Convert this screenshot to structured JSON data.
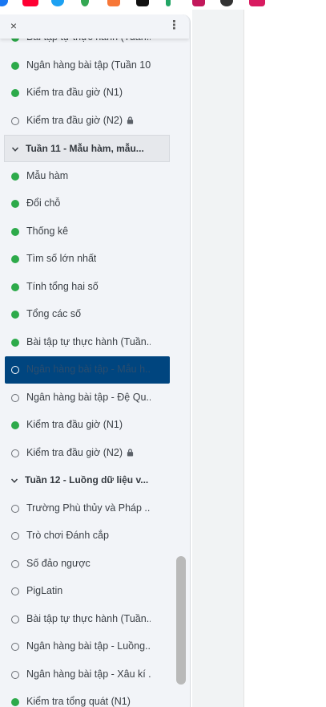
{
  "panel": {
    "close_icon": "×",
    "menu_icon": "⋮"
  },
  "items": [
    {
      "label": "Bài tập tự thực hành (Tuần...",
      "status": "done"
    },
    {
      "label": "Ngân hàng bài tập (Tuần 10)",
      "status": "done"
    },
    {
      "label": "Kiểm tra đầu giờ (N1)",
      "status": "done"
    },
    {
      "label": "Kiểm tra đầu giờ (N2)",
      "status": "todo",
      "locked": true
    },
    {
      "section": "Tuần 11 - Mẫu hàm, mẫu..."
    },
    {
      "label": "Mẫu hàm",
      "status": "done"
    },
    {
      "label": "Đổi chỗ",
      "status": "done"
    },
    {
      "label": "Thống kê",
      "status": "done"
    },
    {
      "label": "Tìm số lớn nhất",
      "status": "done"
    },
    {
      "label": "Tính tổng hai số",
      "status": "done"
    },
    {
      "label": "Tổng các số",
      "status": "done"
    },
    {
      "label": "Bài tập tự thực hành (Tuần...",
      "status": "done"
    },
    {
      "label": "Ngân hàng bài tập - Mẫu h...",
      "status": "todo",
      "active": true
    },
    {
      "label": "Ngân hàng bài tập - Đệ Qu...",
      "status": "todo"
    },
    {
      "label": "Kiểm tra đầu giờ (N1)",
      "status": "done"
    },
    {
      "label": "Kiểm tra đầu giờ (N2)",
      "status": "todo",
      "locked": true
    },
    {
      "section": "Tuần 12 - Luồng dữ liệu v..."
    },
    {
      "label": "Trường Phù thủy và Pháp ...",
      "status": "todo"
    },
    {
      "label": "Trò chơi Đánh cắp",
      "status": "todo"
    },
    {
      "label": "Số đảo ngược",
      "status": "todo"
    },
    {
      "label": "PigLatin",
      "status": "todo"
    },
    {
      "label": "Bài tập tự thực hành (Tuần...",
      "status": "todo"
    },
    {
      "label": "Ngân hàng bài tập - Luồng...",
      "status": "todo"
    },
    {
      "label": "Ngân hàng bài tập - Xâu kí ...",
      "status": "todo"
    },
    {
      "label": "Kiểm tra tổng quát (N1)",
      "status": "done"
    }
  ],
  "colors": {
    "done": "#2daa4a",
    "active_bg": "#00457f"
  }
}
